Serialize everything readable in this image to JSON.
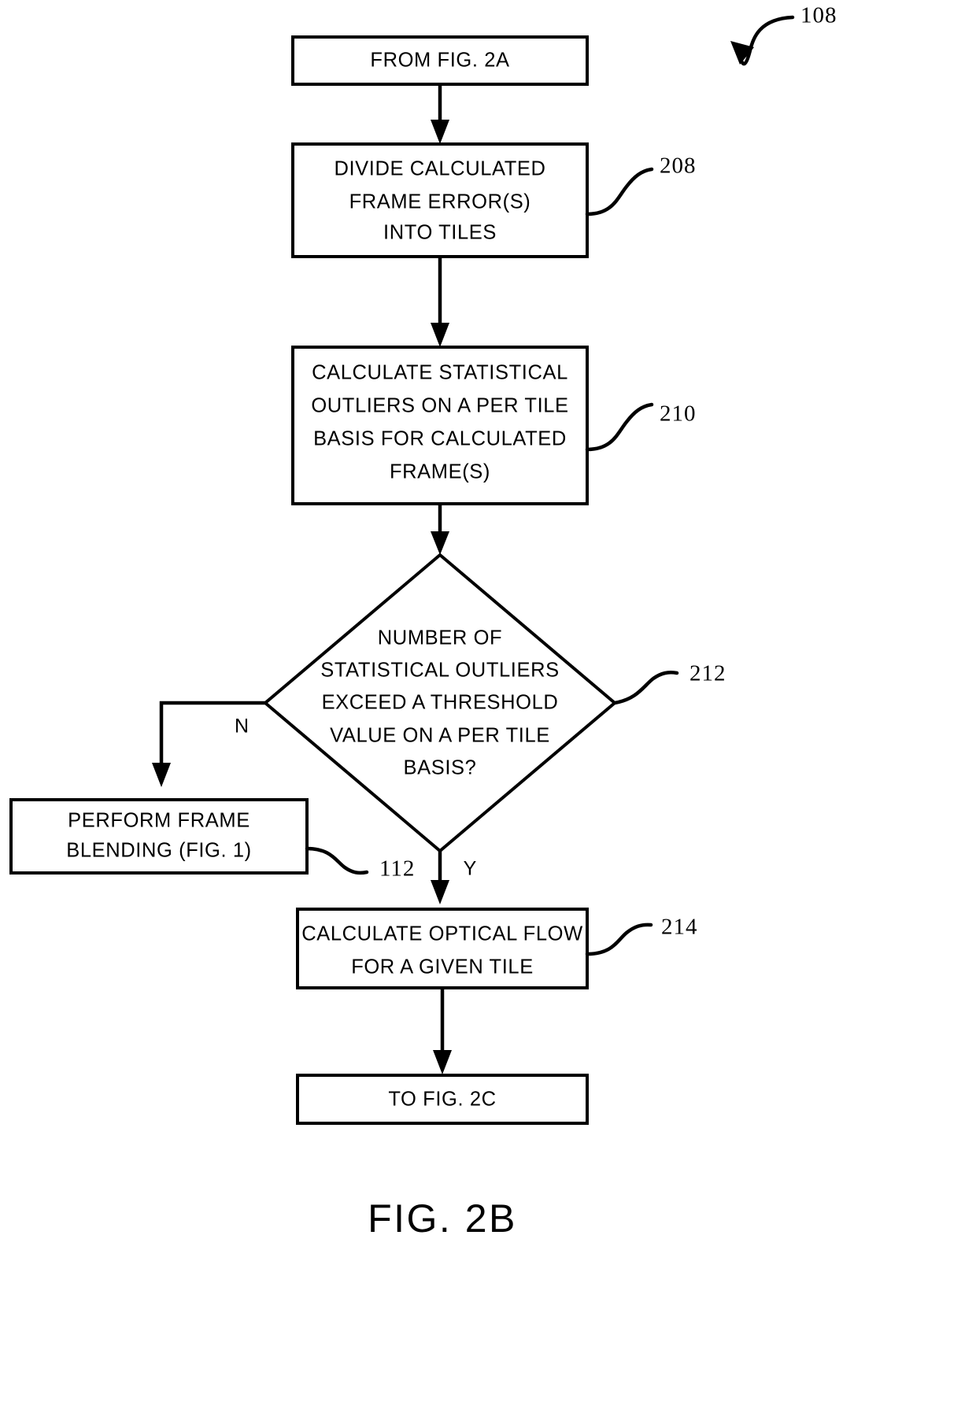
{
  "figure": {
    "caption": "FIG. 2B",
    "sheet_reference": "108"
  },
  "nodes": {
    "entry": {
      "ref": "",
      "lines": [
        "FROM FIG. 2A"
      ]
    },
    "divide": {
      "ref": "208",
      "lines": [
        "DIVIDE CALCULATED",
        "FRAME ERROR(S)",
        "INTO TILES"
      ]
    },
    "outliers": {
      "ref": "210",
      "lines": [
        "CALCULATE STATISTICAL",
        "OUTLIERS ON A PER TILE",
        "BASIS FOR CALCULATED",
        "FRAME(S)"
      ]
    },
    "decision": {
      "ref": "212",
      "lines": [
        "NUMBER OF",
        "STATISTICAL OUTLIERS",
        "EXCEED A THRESHOLD",
        "VALUE ON A PER TILE",
        "BASIS?"
      ]
    },
    "blending": {
      "ref": "112",
      "lines": [
        "PERFORM FRAME",
        "BLENDING (FIG. 1)"
      ]
    },
    "optical_flow": {
      "ref": "214",
      "lines": [
        "CALCULATE OPTICAL FLOW",
        "FOR A GIVEN TILE"
      ]
    },
    "exit": {
      "ref": "",
      "lines": [
        "TO FIG. 2C"
      ]
    }
  },
  "branches": {
    "no_label": "N",
    "yes_label": "Y"
  },
  "colors": {
    "ink": "#000000",
    "paper": "#ffffff"
  }
}
